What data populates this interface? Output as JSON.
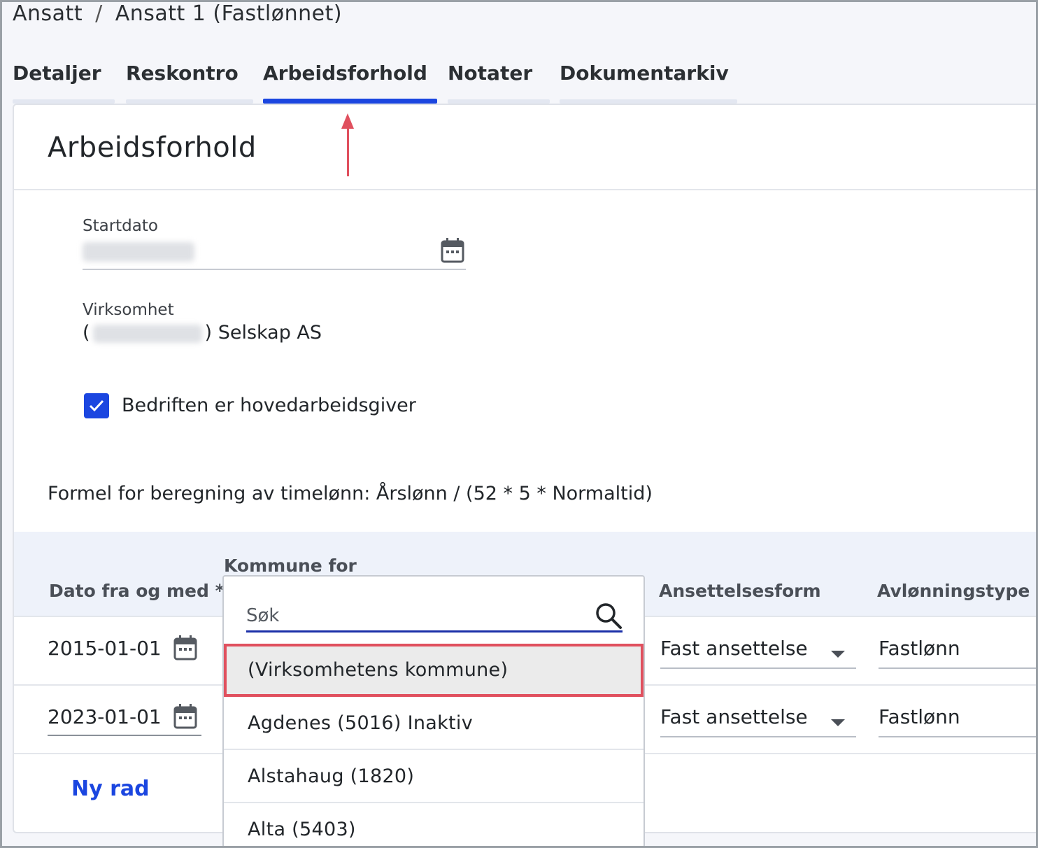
{
  "breadcrumb": {
    "parent": "Ansatt",
    "separator": "/",
    "current": "Ansatt 1 (Fastlønnet)"
  },
  "tabs": [
    {
      "label": "Detaljer",
      "active": false
    },
    {
      "label": "Reskontro",
      "active": false
    },
    {
      "label": "Arbeidsforhold",
      "active": true
    },
    {
      "label": "Notater",
      "active": false
    },
    {
      "label": "Dokumentarkiv",
      "active": false
    }
  ],
  "section": {
    "title": "Arbeidsforhold"
  },
  "startdato": {
    "label": "Startdato",
    "icon": "calendar-icon"
  },
  "virksomhet": {
    "label": "Virksomhet",
    "open_paren": "(",
    "close_paren": ")",
    "name": "Selskap AS"
  },
  "hovedarbeidsgiver": {
    "label": "Bedriften er hovedarbeidsgiver",
    "checked": true
  },
  "formula": "Formel for beregning av timelønn: Årslønn / (52 * 5 * Normaltid)",
  "table": {
    "headers": {
      "dato": "Dato fra og med *",
      "kommune": "Kommune for",
      "ansettelsesform": "Ansettelsesform",
      "avlonningstype": "Avlønningstype"
    },
    "rows": [
      {
        "dato": "2015-01-01",
        "ansettelsesform": "Fast ansettelse",
        "avlonningstype": "Fastlønn"
      },
      {
        "dato": "2023-01-01",
        "ansettelsesform": "Fast ansettelse",
        "avlonningstype": "Fastlønn"
      }
    ],
    "add_row_label": "Ny rad"
  },
  "dropdown": {
    "search_placeholder": "Søk",
    "options": [
      {
        "label": "(Virksomhetens kommune)",
        "highlighted": true
      },
      {
        "label": "Agdenes (5016) Inaktiv"
      },
      {
        "label": "Alstahaug (1820)"
      },
      {
        "label": "Alta (5403)"
      }
    ]
  },
  "colors": {
    "accent": "#1b46e0",
    "highlight_border": "#e0505e",
    "arrow": "#e0505e"
  }
}
